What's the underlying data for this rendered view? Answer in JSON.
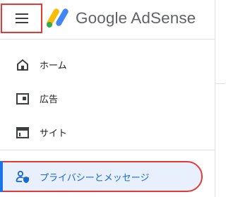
{
  "header": {
    "app_name": "Google AdSense",
    "icons": {
      "menu": "hamburger-menu-icon",
      "logo": "adsense-logo-icon"
    }
  },
  "nav": {
    "items": [
      {
        "label": "ホーム",
        "icon": "home-icon"
      },
      {
        "label": "広告",
        "icon": "ads-icon"
      },
      {
        "label": "サイト",
        "icon": "sites-icon"
      },
      {
        "label": "プライバシーとメッセージ",
        "icon": "privacy-messaging-icon",
        "active": true
      }
    ]
  },
  "colors": {
    "highlight_border": "#e53935",
    "active_bg": "#e8f0fe",
    "active_text": "#1967d2",
    "logo_yellow": "#fbbc04",
    "logo_blue": "#4285f4",
    "logo_green": "#34a853"
  }
}
